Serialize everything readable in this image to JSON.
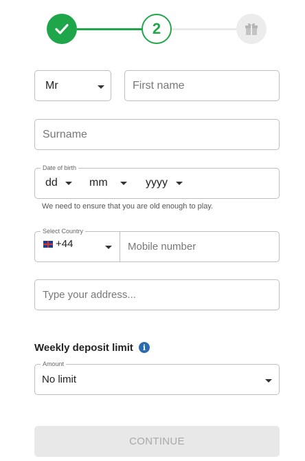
{
  "stepper": {
    "current_step_label": "2",
    "active_color": "#20a64a",
    "inactive_color": "#ececec",
    "steps": [
      {
        "state": "completed",
        "icon": "checkmark-icon"
      },
      {
        "state": "current",
        "label": "2"
      },
      {
        "state": "upcoming",
        "icon": "gift-icon"
      }
    ]
  },
  "title": {
    "value": "Mr"
  },
  "first_name": {
    "placeholder": "First name"
  },
  "surname": {
    "placeholder": "Surname"
  },
  "dob": {
    "label": "Date of birth",
    "day_placeholder": "dd",
    "month_placeholder": "mm",
    "year_placeholder": "yyyy",
    "helper": "We need to ensure that you are old enough to play."
  },
  "phone": {
    "country_label": "Select Country",
    "country_code": "+44",
    "country_flag": "uk-flag-icon",
    "placeholder": "Mobile number"
  },
  "address": {
    "placeholder": "Type your address..."
  },
  "deposit": {
    "title": "Weekly deposit limit",
    "amount_label": "Amount",
    "amount_value": "No limit"
  },
  "continue_label": "CONTINUE"
}
